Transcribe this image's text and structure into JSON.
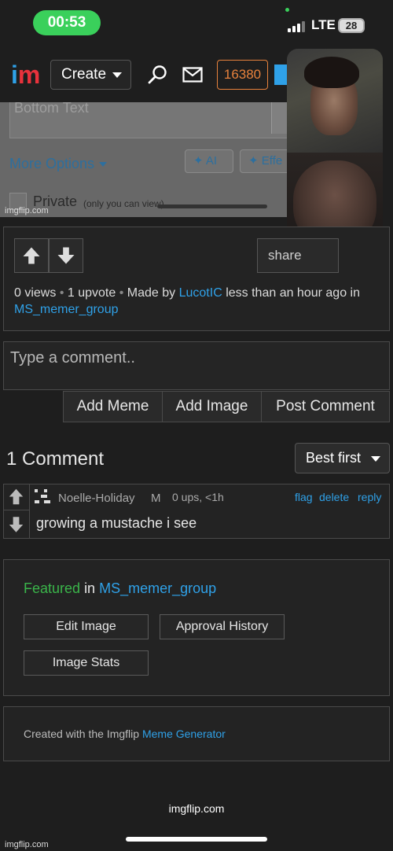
{
  "status_bar": {
    "time": "00:53",
    "network": "LTE",
    "battery": "28"
  },
  "nav": {
    "logo_i": "i",
    "logo_m": "m",
    "create_label": "Create",
    "points": "16380"
  },
  "preview": {
    "bottom_text_placeholder": "Bottom Text",
    "more_options": "More Options",
    "ai_label": "AI",
    "effects_label": "Effe",
    "private_label": "Private",
    "private_note": "(only you can view)",
    "watermark": "imgflip.com"
  },
  "stats": {
    "share_label": "share",
    "views": "0 views",
    "sep": "•",
    "upvotes": "1 upvote",
    "made_by": "Made by",
    "author": "LucotIC",
    "when": "less than an hour ago in",
    "stream": "MS_memer_group"
  },
  "comment_box": {
    "placeholder": "Type a comment..",
    "add_meme": "Add Meme",
    "add_image": "Add Image",
    "post_comment": "Post Comment"
  },
  "comments": {
    "count_label": "1 Comment",
    "sort_label": "Best first",
    "items": [
      {
        "user": "Noelle-Holiday",
        "badge": "M",
        "meta": "0 ups, <1h",
        "flag": "flag",
        "delete": "delete",
        "reply": "reply",
        "text": "growing a mustache i see"
      }
    ]
  },
  "featured": {
    "status": "Featured",
    "in": "in",
    "stream": "MS_memer_group",
    "edit_image": "Edit Image",
    "approval_history": "Approval History",
    "image_stats": "Image Stats"
  },
  "credit": {
    "prefix": "Created with the Imgflip",
    "link": "Meme Generator"
  },
  "footer": {
    "domain": "imgflip.com",
    "watermark": "imgflip.com"
  },
  "colors": {
    "accent": "#2fa1e8",
    "logo_red": "#e8323c",
    "points_orange": "#e8823c",
    "featured_green": "#3ab54a",
    "clock_green": "#3ad05b"
  }
}
